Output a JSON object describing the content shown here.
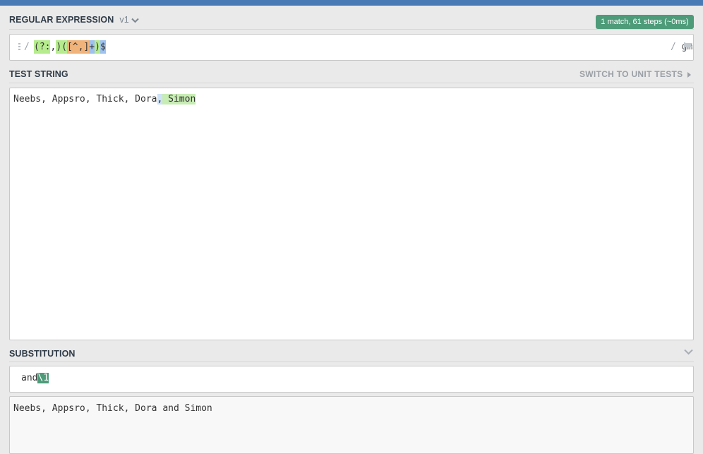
{
  "regex_section": {
    "label": "REGULAR EXPRESSION",
    "version": "v1",
    "match_info": "1 match, 61 steps (~0ms)",
    "open_delimiter": "/",
    "close_delimiter": "/",
    "flags": "gm",
    "tokens": [
      {
        "text": "(?:",
        "style": "green"
      },
      {
        "text": ",",
        "style": "none"
      },
      {
        "text": ")",
        "style": "green"
      },
      {
        "text": "(",
        "style": "green"
      },
      {
        "text": "[",
        "style": "orange"
      },
      {
        "text": "^,",
        "style": "orange"
      },
      {
        "text": "]",
        "style": "orange"
      },
      {
        "text": "+",
        "style": "blue"
      },
      {
        "text": ")",
        "style": "green"
      },
      {
        "text": "$",
        "style": "blue"
      }
    ]
  },
  "test_section": {
    "label": "TEST STRING",
    "switch_label": "SWITCH TO UNIT TESTS",
    "text_before": "Neebs, Appsro, Thick, Dora",
    "match_group_noncap": ",",
    "match_group_1": " Simon"
  },
  "substitution_section": {
    "label": "SUBSTITUTION",
    "input_text": "and",
    "input_ref": "\\1",
    "result": "Neebs, Appsro, Thick, Dora and Simon"
  },
  "colors": {
    "accent": "#4a7ab5",
    "badge": "#4e9b79"
  }
}
